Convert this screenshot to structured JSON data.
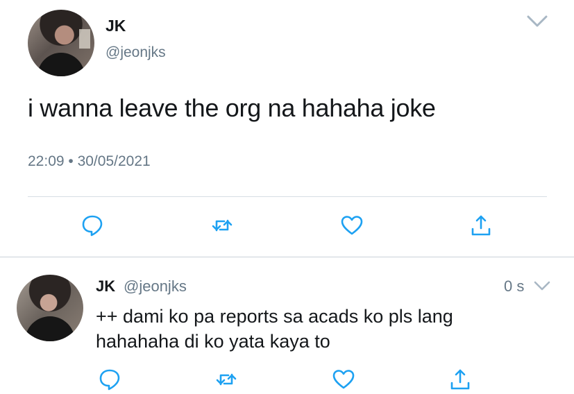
{
  "main_tweet": {
    "name": "JK",
    "handle": "@jeonjks",
    "text": "i wanna leave the org na hahaha joke",
    "meta": "22:09 • 30/05/2021",
    "icons": [
      "chevron-down-icon",
      "reply-icon",
      "retweet-icon",
      "like-icon",
      "share-icon"
    ]
  },
  "reply_tweet": {
    "name": "JK",
    "handle": "@jeonjks",
    "time": "0 s",
    "line1": "++ dami ko pa reports sa acads ko pls lang",
    "line2": "hahahaha di ko yata kaya to",
    "icons": [
      "chevron-down-icon",
      "reply-icon",
      "retweet-icon",
      "like-icon",
      "share-icon"
    ]
  },
  "colors": {
    "text": "#14171a",
    "secondary": "#657786",
    "icon": "#1da1f2",
    "divider": "#d6dde3"
  }
}
